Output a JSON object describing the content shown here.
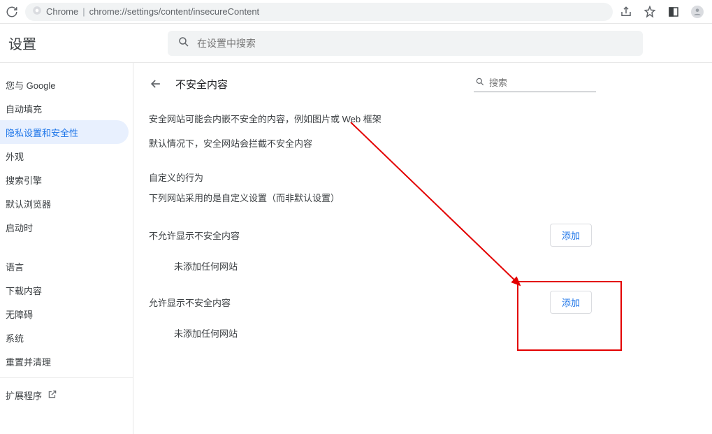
{
  "omnibox": {
    "chrome_label": "Chrome",
    "url": "chrome://settings/content/insecureContent"
  },
  "header": {
    "title": "设置",
    "search_placeholder": "在设置中搜索"
  },
  "sidebar": {
    "items": [
      {
        "label": "您与 Google"
      },
      {
        "label": "自动填充"
      },
      {
        "label": "隐私设置和安全性",
        "active": true
      },
      {
        "label": "外观"
      },
      {
        "label": "搜索引擎"
      },
      {
        "label": "默认浏览器"
      },
      {
        "label": "启动时"
      }
    ],
    "items2": [
      {
        "label": "语言"
      },
      {
        "label": "下载内容"
      },
      {
        "label": "无障碍"
      },
      {
        "label": "系统"
      },
      {
        "label": "重置并清理"
      }
    ],
    "extensions": "扩展程序"
  },
  "page": {
    "title": "不安全内容",
    "search_placeholder": "搜索",
    "desc1": "安全网站可能会内嵌不安全的内容，例如图片或 Web 框架",
    "desc2": "默认情况下，安全网站会拦截不安全内容",
    "custom_title": "自定义的行为",
    "custom_sub": "下列网站采用的是自定义设置（而非默认设置）",
    "block": {
      "label": "不允许显示不安全内容",
      "add": "添加",
      "empty": "未添加任何网站"
    },
    "allow": {
      "label": "允许显示不安全内容",
      "add": "添加",
      "empty": "未添加任何网站"
    }
  }
}
